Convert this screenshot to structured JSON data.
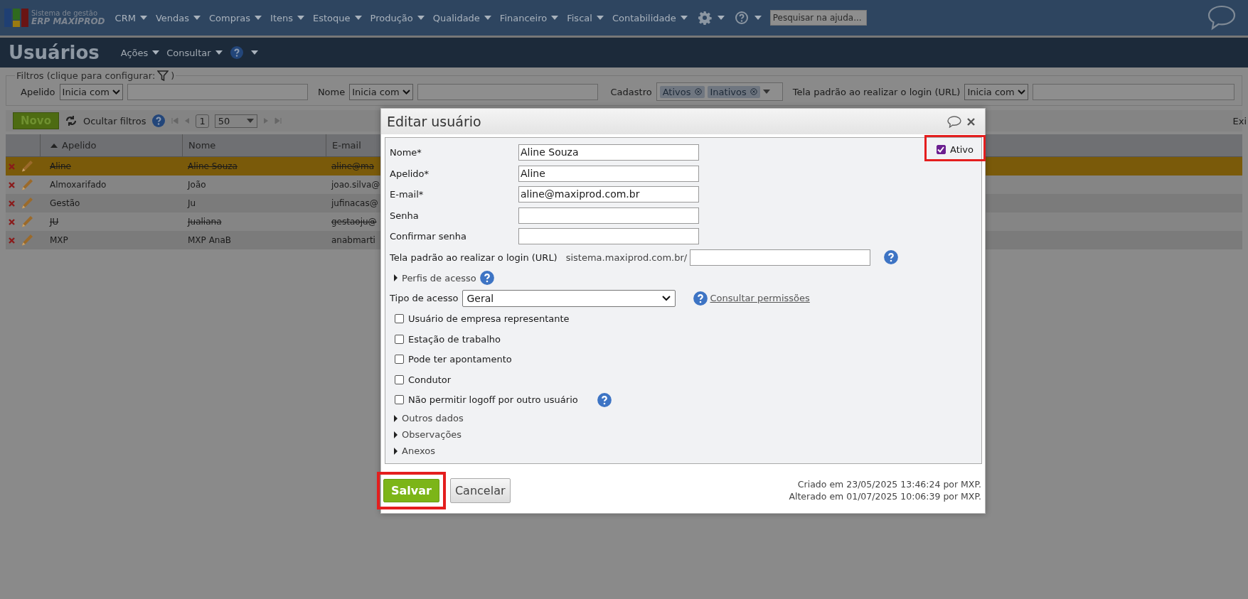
{
  "app": {
    "logo_line1": "Sistema de gestão",
    "logo_line2": "ERP MAXIPROD"
  },
  "menu": [
    "CRM",
    "Vendas",
    "Compras",
    "Itens",
    "Estoque",
    "Produção",
    "Qualidade",
    "Financeiro",
    "Fiscal",
    "Contabilidade"
  ],
  "help_search": {
    "placeholder": "Pesquisar na ajuda..."
  },
  "page": {
    "title": "Usuários",
    "actions": [
      "Ações",
      "Consultar"
    ]
  },
  "filters": {
    "legend": "Filtros (clique para configurar:",
    "legend_end": ")",
    "fields": [
      {
        "label": "Apelido",
        "operator": "Inicia com"
      },
      {
        "label": "Nome",
        "operator": "Inicia com"
      }
    ],
    "cadastro": {
      "label": "Cadastro",
      "tags": [
        "Ativos",
        "Inativos"
      ]
    },
    "login": {
      "label": "Tela padrão ao realizar o login (URL)",
      "operator": "Inicia com"
    }
  },
  "toolbar": {
    "new": "Novo",
    "hide_filters": "Ocultar filtros",
    "page": "1",
    "page_size": "50",
    "right": "Exi"
  },
  "table": {
    "columns": [
      "Apelido",
      "Nome",
      "E-mail"
    ],
    "rows": [
      {
        "apelido": "Aline",
        "nome": "Aline Souza",
        "email": "aline@ma",
        "active": false,
        "selected": true
      },
      {
        "apelido": "Almoxarifado",
        "nome": "João",
        "email": "joao.silva@",
        "active": true,
        "selected": false
      },
      {
        "apelido": "Gestão",
        "nome": "Ju",
        "email": "jufinacas@",
        "active": true,
        "selected": false
      },
      {
        "apelido": "JU",
        "nome": "Jualiana",
        "email": "gestaoju@",
        "active": false,
        "selected": false
      },
      {
        "apelido": "MXP",
        "nome": "MXP AnaB",
        "email": "anabmarti",
        "active": true,
        "selected": false
      }
    ]
  },
  "dialog": {
    "title": "Editar usuário",
    "active": {
      "label": "Ativo",
      "checked": true,
      "highlighted": true
    },
    "fields": [
      {
        "label": "Nome*",
        "value": "Aline Souza"
      },
      {
        "label": "Apelido*",
        "value": "Aline"
      },
      {
        "label": "E-mail*",
        "value": "aline@maxiprod.com.br"
      },
      {
        "label": "Senha"
      },
      {
        "label": "Confirmar senha"
      }
    ],
    "login": {
      "label": "Tela padrão ao realizar o login (URL)",
      "prefix": "sistema.maxiprod.com.br/"
    },
    "profiles": {
      "label": "Perfis de acesso",
      "expanded": false
    },
    "access": {
      "label": "Tipo de acesso",
      "value": "Geral",
      "link": "Consultar permissões"
    },
    "checkboxes": [
      {
        "label": "Usuário de empresa representante",
        "checked": false
      },
      {
        "label": "Estação de trabalho",
        "checked": false
      },
      {
        "label": "Pode ter apontamento",
        "checked": false
      },
      {
        "label": "Condutor",
        "checked": false
      },
      {
        "label": "Não permitir logoff por outro usuário",
        "checked": false,
        "help": true
      }
    ],
    "sections": [
      {
        "label": "Outros dados",
        "expanded": false
      },
      {
        "label": "Observações",
        "expanded": false
      },
      {
        "label": "Anexos",
        "expanded": false
      }
    ],
    "save": {
      "label": "Salvar",
      "highlighted": true
    },
    "cancel": "Cancelar",
    "created": "Criado em 23/05/2025 13:46:24 por MXP.",
    "changed": "Alterado em 01/07/2025 10:06:39 por MXP."
  }
}
